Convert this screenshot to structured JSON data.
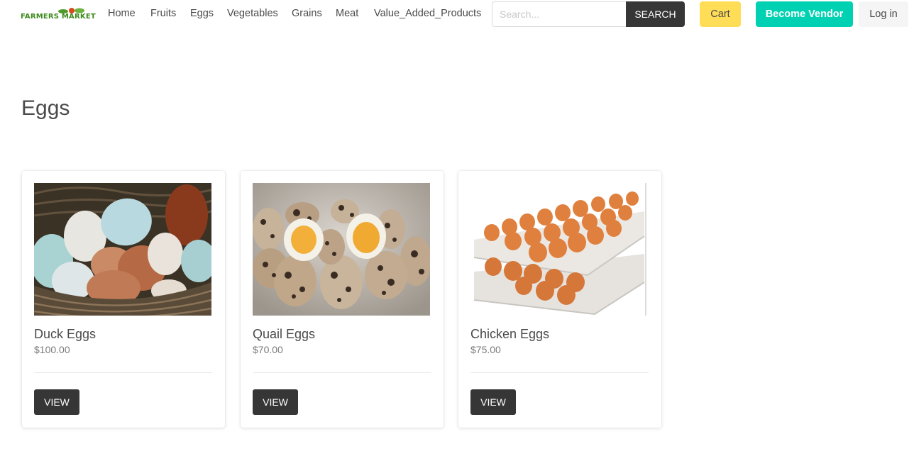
{
  "brand": {
    "logo_text": "FARMERS MARKET"
  },
  "nav": {
    "links": [
      "Home",
      "Fruits",
      "Eggs",
      "Vegetables",
      "Grains",
      "Meat",
      "Value_Added_Products"
    ]
  },
  "search": {
    "placeholder": "Search...",
    "button_label": "SEARCH"
  },
  "actions": {
    "cart": "Cart",
    "vendor": "Become Vendor",
    "login": "Log in"
  },
  "page": {
    "title": "Eggs"
  },
  "products": [
    {
      "name": "Duck Eggs",
      "price": "$100.00",
      "button": "VIEW",
      "image": "duck-eggs-in-basket"
    },
    {
      "name": "Quail Eggs",
      "price": "$70.00",
      "button": "VIEW",
      "image": "quail-eggs-halved"
    },
    {
      "name": "Chicken Eggs",
      "price": "$75.00",
      "button": "VIEW",
      "image": "chicken-eggs-in-trays"
    }
  ],
  "colors": {
    "accent_vendor": "#00d1b2",
    "accent_cart": "#ffdd57",
    "dark_button": "#363636",
    "logo_green": "#3e8a1e"
  }
}
